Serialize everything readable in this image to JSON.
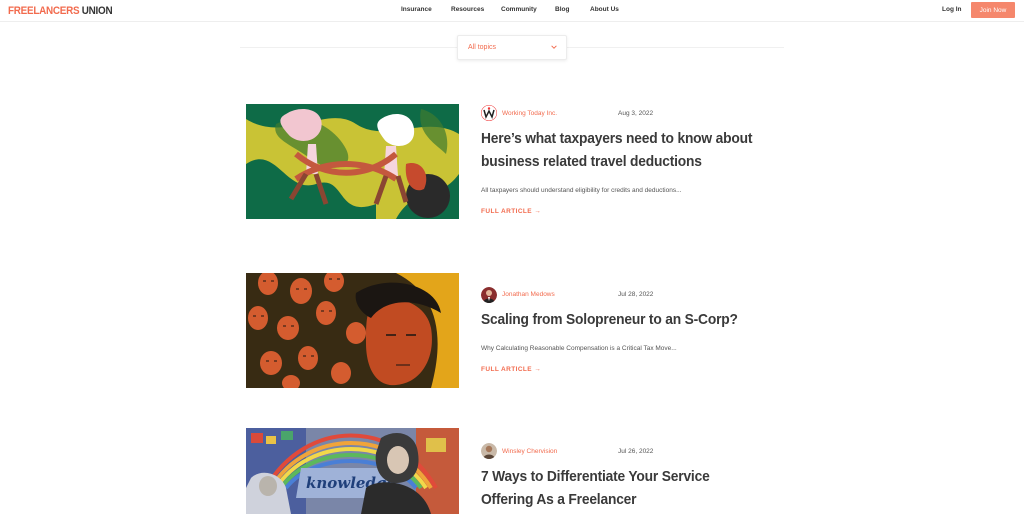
{
  "header": {
    "logo_part1": "FREELANCERS",
    "logo_part2": "UNION",
    "nav": [
      "Insurance",
      "Resources",
      "Community",
      "Blog",
      "About Us"
    ],
    "login": "Log In",
    "join": "Join Now"
  },
  "filter": {
    "label": "All topics"
  },
  "articles": [
    {
      "author": "Working Today Inc.",
      "date": "Aug 3, 2022",
      "title": "Here’s what taxpayers need to know about business related travel deductions",
      "excerpt": "All taxpayers should understand eligibility for credits and deductions...",
      "link": "FULL ARTICLE"
    },
    {
      "author": "Jonathan Medows",
      "date": "Jul 28, 2022",
      "title": "Scaling from Solopreneur to an S-Corp?",
      "excerpt": "Why Calculating Reasonable Compensation is a Critical Tax Move...",
      "link": "FULL ARTICLE"
    },
    {
      "author": "Winsley Chervision",
      "date": "Jul 26, 2022",
      "title": "7 Ways to Differentiate Your Service Offering As a Freelancer",
      "excerpt": "",
      "link": "",
      "image_text": "knowledge"
    }
  ],
  "colors": {
    "accent": "#f26b4e",
    "button": "#f5876c"
  }
}
